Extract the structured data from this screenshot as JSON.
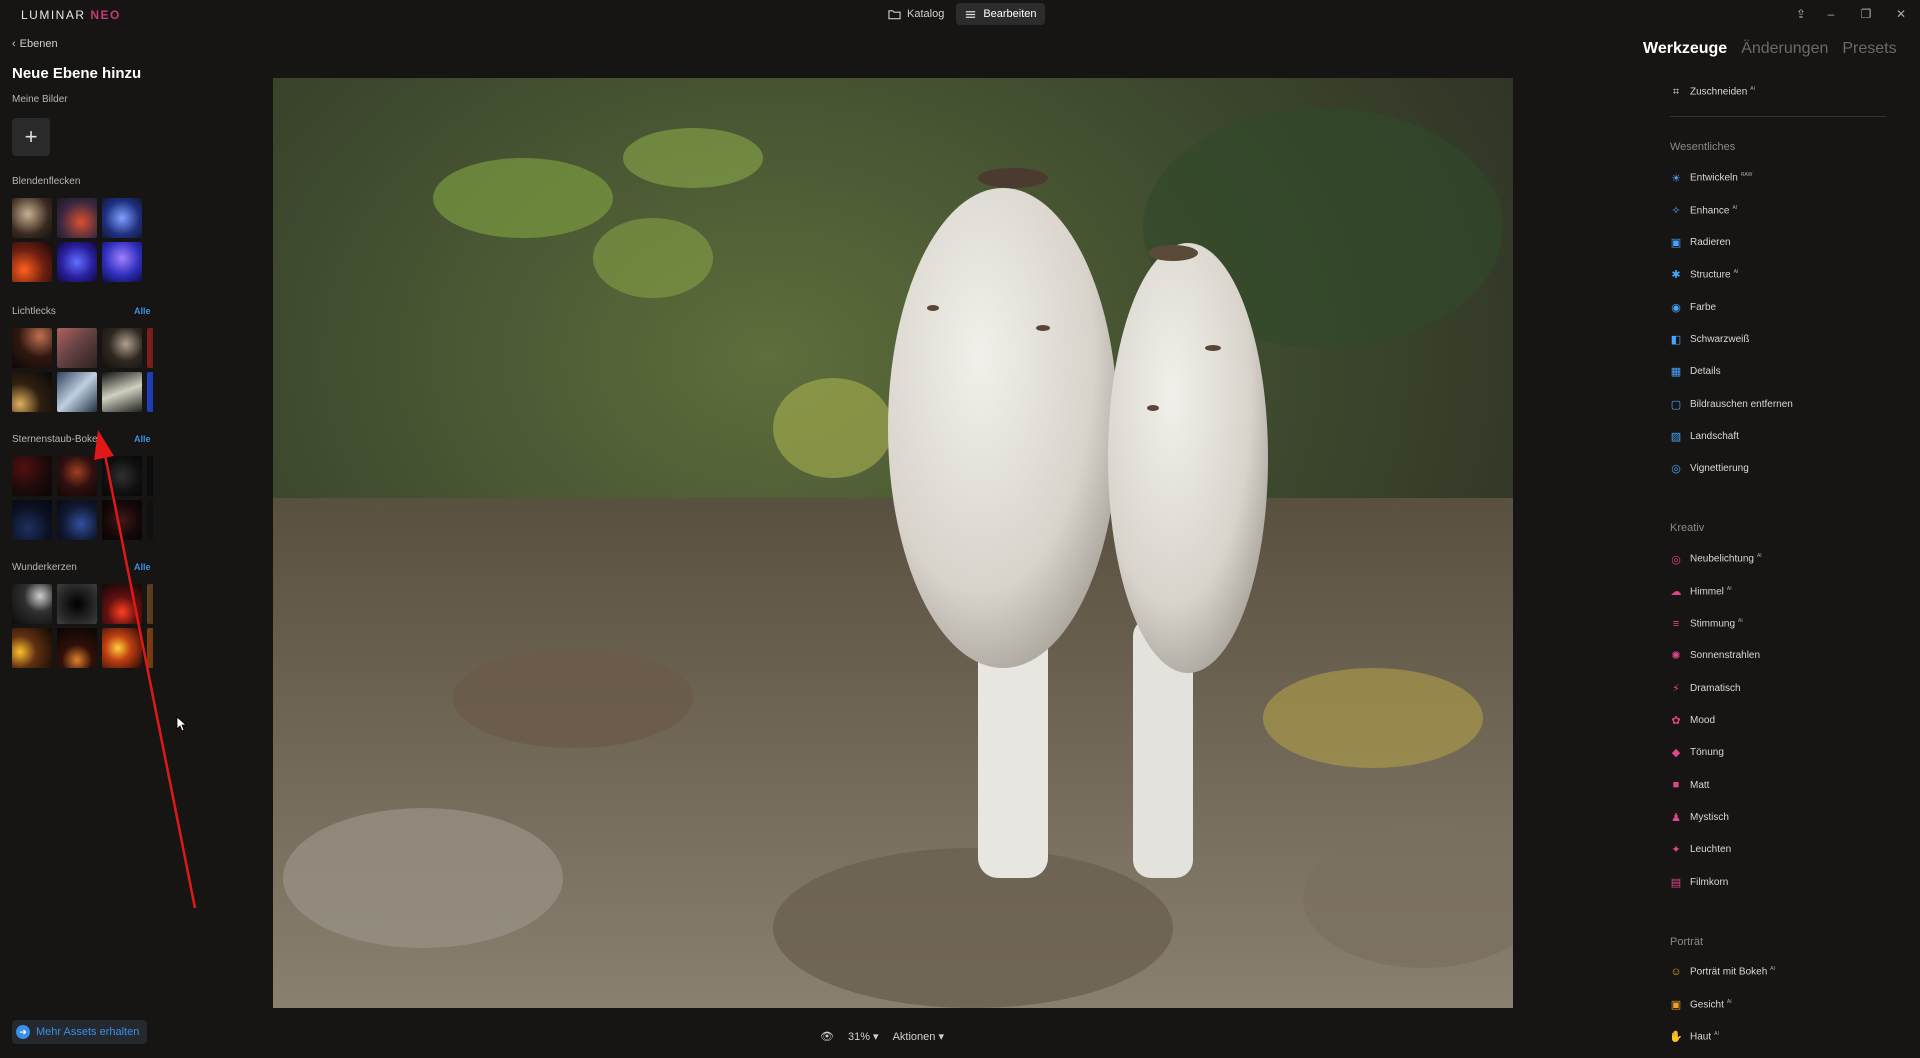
{
  "app": {
    "logo_a": "LUMINAR",
    "logo_b": "NEO"
  },
  "modes": [
    {
      "label": "Katalog"
    },
    {
      "label": "Bearbeiten"
    }
  ],
  "left": {
    "back_label": "Ebenen",
    "title": "Neue Ebene hinzu",
    "my_images": "Meine Bilder",
    "sections": [
      {
        "label": "Blendenflecken",
        "alle": ""
      },
      {
        "label": "Lichtlecks",
        "alle": "Alle"
      },
      {
        "label": "Sternenstaub-Bokeh",
        "alle": "Alle"
      },
      {
        "label": "Wunderkerzen",
        "alle": "Alle"
      }
    ],
    "more_assets": "Mehr Assets erhalten"
  },
  "bottom": {
    "zoom": "31%",
    "actions": "Aktionen"
  },
  "right": {
    "tabs": [
      "Werkzeuge",
      "Änderungen",
      "Presets"
    ],
    "crop": "Zuschneiden",
    "section_essentials": "Wesentliches",
    "essentials": [
      "Entwickeln",
      "Enhance",
      "Radieren",
      "Structure",
      "Farbe",
      "Schwarzweiß",
      "Details",
      "Bildrauschen entfernen",
      "Landschaft",
      "Vignettierung"
    ],
    "section_creative": "Kreativ",
    "creative": [
      "Neubelichtung",
      "Himmel",
      "Stimmung",
      "Sonnenstrahlen",
      "Dramatisch",
      "Mood",
      "Tönung",
      "Matt",
      "Mystisch",
      "Leuchten",
      "Filmkorn"
    ],
    "section_portrait": "Porträt",
    "portrait": [
      "Porträt mit Bokeh",
      "Gesicht",
      "Haut"
    ],
    "tags": {
      "raw": "RAW",
      "ai": "AI"
    }
  },
  "colors": {
    "accent_blue": "#3a8fe8",
    "creative_pink": "#e0468a",
    "essential_blue": "#4aa3ff",
    "portrait_orange": "#f0a030"
  }
}
